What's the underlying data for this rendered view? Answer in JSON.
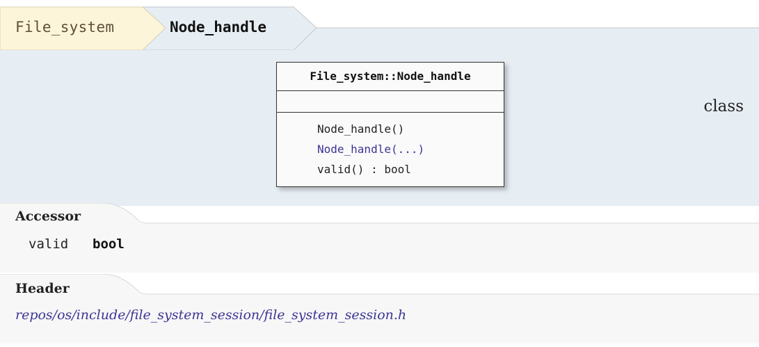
{
  "breadcrumb": {
    "parent": "File_system",
    "current": "Node_handle"
  },
  "kind": "class",
  "uml": {
    "title": "File_system::Node_handle",
    "operations": [
      {
        "text": "Node_handle()",
        "link": false
      },
      {
        "text": "Node_handle(...)",
        "link": true
      },
      {
        "text": "valid() : bool",
        "link": false
      }
    ]
  },
  "sections": {
    "accessor": {
      "title": "Accessor",
      "name": "valid",
      "type": "bool"
    },
    "header": {
      "title": "Header",
      "path": "repos/os/include/file_system_session/file_system_session.h"
    }
  },
  "colors": {
    "parent_crumb_bg": "#fdf5da",
    "current_crumb_bg": "#e6edf3",
    "class_area_bg": "#e6edf3",
    "section_bg": "#f7f7f7",
    "link": "#3b3594"
  }
}
